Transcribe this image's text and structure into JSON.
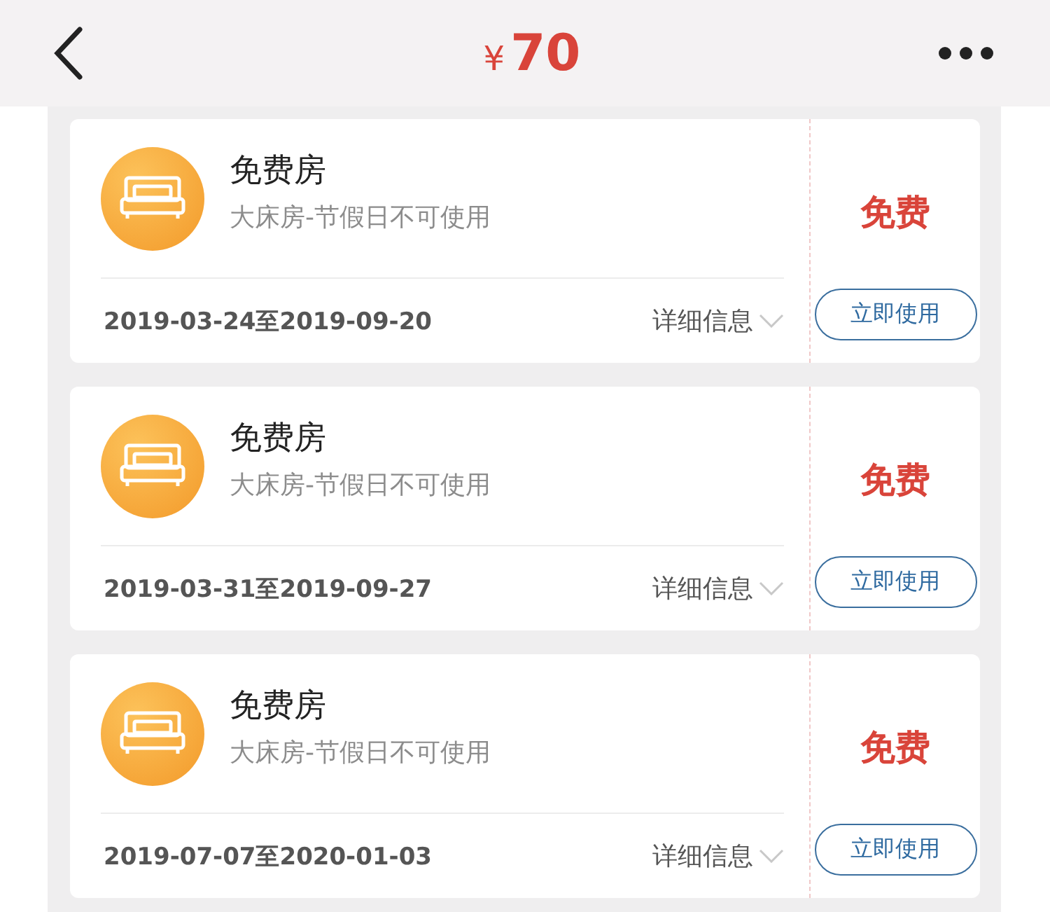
{
  "header": {
    "currency": "¥",
    "amount": "70"
  },
  "coupons": [
    {
      "title": "免费房",
      "subtitle": "大床房-节假日不可使用",
      "dates": "2019-03-24至2019-09-20",
      "details": "详细信息",
      "price": "免费",
      "action": "立即使用"
    },
    {
      "title": "免费房",
      "subtitle": "大床房-节假日不可使用",
      "dates": "2019-03-31至2019-09-27",
      "details": "详细信息",
      "price": "免费",
      "action": "立即使用"
    },
    {
      "title": "免费房",
      "subtitle": "大床房-节假日不可使用",
      "dates": "2019-07-07至2020-01-03",
      "details": "详细信息",
      "price": "免费",
      "action": "立即使用"
    }
  ]
}
